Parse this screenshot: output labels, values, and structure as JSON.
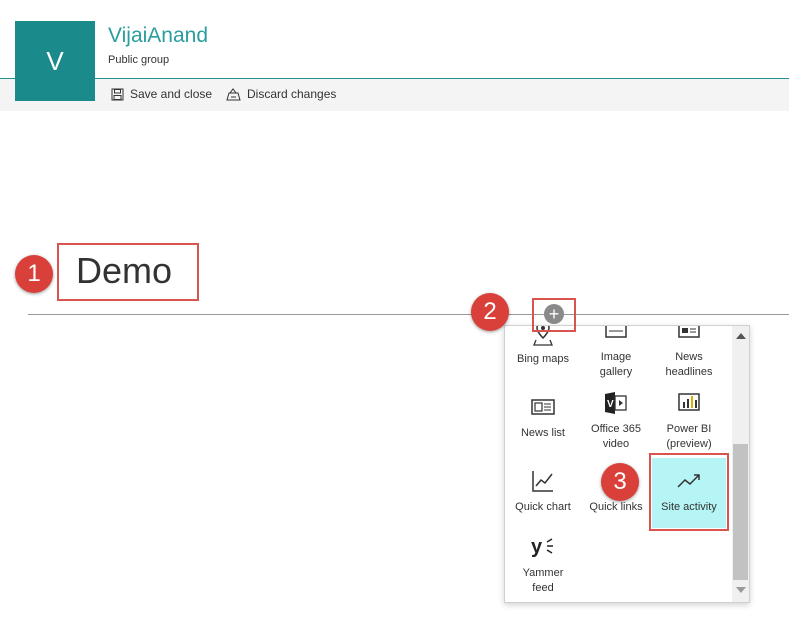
{
  "header": {
    "logo_letter": "V",
    "site_title": "VijaiAnand",
    "site_subtitle": "Public group"
  },
  "commandbar": {
    "save_label": "Save and close",
    "discard_label": "Discard changes"
  },
  "page": {
    "title": "Demo"
  },
  "steps": [
    "1",
    "2",
    "3"
  ],
  "add_button": {
    "glyph": "+"
  },
  "webparts": [
    {
      "label": "Bing maps",
      "icon": "map-icon"
    },
    {
      "label": "Image gallery",
      "icon": "image-gallery-icon"
    },
    {
      "label": "News headlines",
      "icon": "news-headlines-icon"
    },
    {
      "label": "News list",
      "icon": "news-list-icon"
    },
    {
      "label": "Office 365 video",
      "icon": "video-icon"
    },
    {
      "label": "Power BI (preview)",
      "icon": "power-bi-icon"
    },
    {
      "label": "Quick chart",
      "icon": "chart-icon"
    },
    {
      "label": "Quick links",
      "icon": "link-icon"
    },
    {
      "label": "Site activity",
      "icon": "activity-icon",
      "selected": true
    },
    {
      "label": "Yammer feed",
      "icon": "yammer-icon"
    }
  ],
  "colors": {
    "brand": "#1a8a8a",
    "title_teal": "#2a9d9d",
    "highlight": "#d9534f",
    "selected_tile": "#b6f5f5"
  }
}
